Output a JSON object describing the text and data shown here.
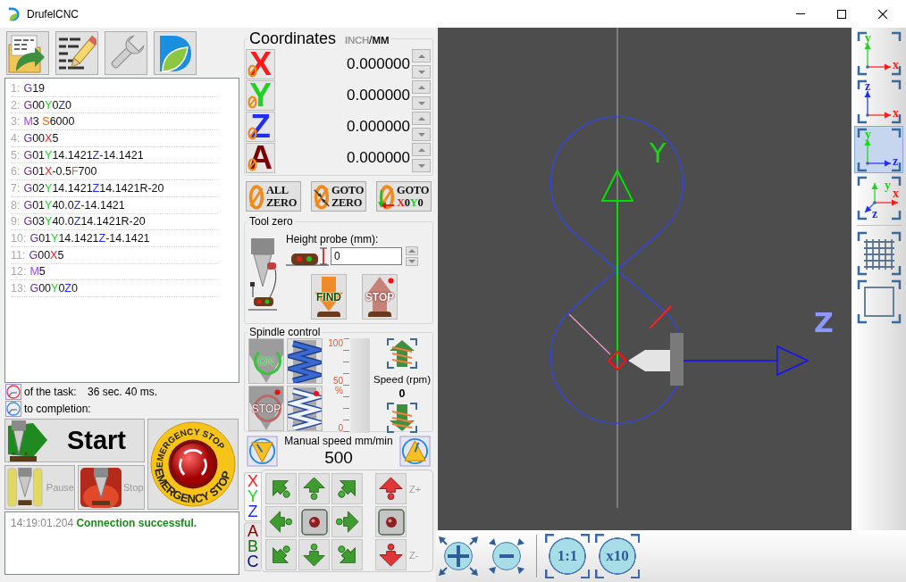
{
  "window": {
    "title": "DrufelCNC"
  },
  "program": {
    "lines": [
      {
        "number": "1:",
        "tokens": [
          {
            "kind": "g",
            "text": "G"
          },
          {
            "kind": "plain",
            "text": "19"
          }
        ]
      },
      {
        "number": "2:",
        "tokens": [
          {
            "kind": "g",
            "text": "G"
          },
          {
            "kind": "plain",
            "text": "00"
          },
          {
            "kind": "y",
            "text": "Y"
          },
          {
            "kind": "plain",
            "text": "0"
          },
          {
            "kind": "z",
            "text": "Z"
          },
          {
            "kind": "plain",
            "text": "0"
          }
        ]
      },
      {
        "number": "3:",
        "tokens": [
          {
            "kind": "m",
            "text": "M"
          },
          {
            "kind": "plain",
            "text": "3 "
          },
          {
            "kind": "feed",
            "text": "S"
          },
          {
            "kind": "plain",
            "text": "6000"
          }
        ]
      },
      {
        "number": "4:",
        "tokens": [
          {
            "kind": "g",
            "text": "G"
          },
          {
            "kind": "plain",
            "text": "00"
          },
          {
            "kind": "x",
            "text": "X"
          },
          {
            "kind": "plain",
            "text": "5"
          }
        ]
      },
      {
        "number": "5:",
        "tokens": [
          {
            "kind": "g",
            "text": "G"
          },
          {
            "kind": "plain",
            "text": "01"
          },
          {
            "kind": "y",
            "text": "Y"
          },
          {
            "kind": "plain",
            "text": "14.1421"
          },
          {
            "kind": "z",
            "text": "Z"
          },
          {
            "kind": "plain",
            "text": "-14.1421"
          }
        ]
      },
      {
        "number": "6:",
        "tokens": [
          {
            "kind": "g",
            "text": "G"
          },
          {
            "kind": "plain",
            "text": "01"
          },
          {
            "kind": "x",
            "text": "X"
          },
          {
            "kind": "plain",
            "text": "-0.5"
          },
          {
            "kind": "feed",
            "text": "F"
          },
          {
            "kind": "plain",
            "text": "700"
          }
        ]
      },
      {
        "number": "7:",
        "tokens": [
          {
            "kind": "g",
            "text": "G"
          },
          {
            "kind": "plain",
            "text": "02"
          },
          {
            "kind": "y",
            "text": "Y"
          },
          {
            "kind": "plain",
            "text": "14.1421"
          },
          {
            "kind": "z",
            "text": "Z"
          },
          {
            "kind": "plain",
            "text": "14.1421R-20"
          }
        ]
      },
      {
        "number": "8:",
        "tokens": [
          {
            "kind": "g",
            "text": "G"
          },
          {
            "kind": "plain",
            "text": "01"
          },
          {
            "kind": "y",
            "text": "Y"
          },
          {
            "kind": "plain",
            "text": "40.0"
          },
          {
            "kind": "z",
            "text": "Z"
          },
          {
            "kind": "plain",
            "text": "-14.1421"
          }
        ]
      },
      {
        "number": "9:",
        "tokens": [
          {
            "kind": "g",
            "text": "G"
          },
          {
            "kind": "plain",
            "text": "03"
          },
          {
            "kind": "y",
            "text": "Y"
          },
          {
            "kind": "plain",
            "text": "40.0"
          },
          {
            "kind": "z",
            "text": "Z"
          },
          {
            "kind": "plain",
            "text": "14.1421R-20"
          }
        ]
      },
      {
        "number": "10:",
        "tokens": [
          {
            "kind": "g",
            "text": "G"
          },
          {
            "kind": "plain",
            "text": "01"
          },
          {
            "kind": "y",
            "text": "Y"
          },
          {
            "kind": "plain",
            "text": "14.1421"
          },
          {
            "kind": "z",
            "text": "Z"
          },
          {
            "kind": "plain",
            "text": "-14.1421"
          }
        ]
      },
      {
        "number": "11:",
        "tokens": [
          {
            "kind": "g",
            "text": "G"
          },
          {
            "kind": "plain",
            "text": "00"
          },
          {
            "kind": "x",
            "text": "X"
          },
          {
            "kind": "plain",
            "text": "5"
          }
        ]
      },
      {
        "number": "12:",
        "tokens": [
          {
            "kind": "m",
            "text": "M"
          },
          {
            "kind": "plain",
            "text": "5"
          }
        ]
      },
      {
        "number": "13:",
        "tokens": [
          {
            "kind": "g",
            "text": "G"
          },
          {
            "kind": "plain",
            "text": "00"
          },
          {
            "kind": "y",
            "text": "Y"
          },
          {
            "kind": "plain",
            "text": "0"
          },
          {
            "kind": "z",
            "text": "Z"
          },
          {
            "kind": "plain",
            "text": "0"
          }
        ]
      }
    ]
  },
  "timers": [
    {
      "label": "of the task:",
      "value": "36 sec. 40 ms."
    },
    {
      "label": "to completion:"
    }
  ],
  "run_controls": [
    {
      "kind": "start",
      "label": "Start",
      "disabled": false
    },
    {
      "kind": "pause",
      "label": "Pause",
      "disabled": true
    },
    {
      "kind": "stop",
      "label": "Stop",
      "disabled": true
    }
  ],
  "emergency_stop": {
    "ring_texts": [
      "EMERGENCY STOP",
      "EMERGENCY STOP"
    ]
  },
  "log": [
    {
      "time": "14:19:01.204",
      "message": "Connection successful.",
      "kind": "success"
    }
  ],
  "coordinates": {
    "title": "Coordinates",
    "units": [
      {
        "label": "INCH",
        "selected": false
      },
      {
        "label": "MM",
        "selected": true
      }
    ],
    "unit_separator": "/",
    "axes": [
      {
        "kind": "x",
        "letter": "X",
        "value": "0.000000"
      },
      {
        "kind": "y",
        "letter": "Y",
        "value": "0.000000"
      },
      {
        "kind": "z",
        "letter": "Z",
        "value": "0.000000"
      },
      {
        "kind": "a",
        "letter": "A",
        "value": "0.000000"
      }
    ]
  },
  "zero_buttons": [
    {
      "kind": "all",
      "lines": [
        [
          {
            "kind": "plain",
            "text": "ALL"
          }
        ],
        [
          {
            "kind": "plain",
            "text": "ZERO"
          }
        ]
      ]
    },
    {
      "kind": "goto-zero",
      "lines": [
        [
          {
            "kind": "plain",
            "text": "GOTO"
          }
        ],
        [
          {
            "kind": "plain",
            "text": "ZERO"
          }
        ]
      ]
    },
    {
      "kind": "goto-xy",
      "lines": [
        [
          {
            "kind": "plain",
            "text": "GOTO"
          }
        ],
        [
          {
            "kind": "x",
            "text": "X"
          },
          {
            "kind": "plain",
            "text": "0"
          },
          {
            "kind": "y",
            "text": "Y"
          },
          {
            "kind": "plain",
            "text": "0"
          }
        ]
      ]
    }
  ],
  "tool_zero": {
    "title": "Tool zero",
    "probe_label": "Height probe (mm):",
    "probe_value": "0",
    "buttons": [
      {
        "kind": "find",
        "label": "FIND",
        "disabled": false
      },
      {
        "kind": "stop",
        "label": "STOP",
        "disabled": true
      }
    ]
  },
  "spindle": {
    "title": "Spindle control",
    "buttons": [
      {
        "kind": "on",
        "label": "ON",
        "disabled": false
      },
      {
        "kind": "stop",
        "label": "STOP",
        "disabled": true
      }
    ],
    "scale_labels": [
      "100",
      "50",
      "%",
      "0"
    ],
    "speed_label": "Speed (rpm)",
    "speed_value": "0"
  },
  "manual_speed": {
    "label": "Manual speed mm/min",
    "value": "500"
  },
  "jog": {
    "tabs": [
      {
        "selected": true,
        "letters": [
          {
            "kind": "x",
            "text": "X"
          },
          {
            "kind": "y",
            "text": "Y"
          },
          {
            "kind": "z",
            "text": "Z"
          }
        ]
      },
      {
        "selected": false,
        "letters": [
          {
            "kind": "a",
            "text": "A"
          },
          {
            "kind": "b",
            "text": "B"
          },
          {
            "kind": "c",
            "text": "C"
          }
        ]
      }
    ],
    "z_labels": [
      "Z+",
      "Z-"
    ]
  },
  "view": {
    "axis_labels": [
      {
        "kind": "y",
        "text": "Y"
      },
      {
        "kind": "z",
        "text": "Z"
      }
    ],
    "view_buttons": [
      {
        "kind": "plane",
        "selected": false,
        "axes": [
          {
            "kind": "y",
            "text": "y"
          },
          {
            "kind": "x",
            "text": "x"
          }
        ]
      },
      {
        "kind": "plane",
        "selected": false,
        "axes": [
          {
            "kind": "z",
            "text": "z"
          },
          {
            "kind": "x",
            "text": "x"
          }
        ]
      },
      {
        "kind": "plane",
        "selected": true,
        "axes": [
          {
            "kind": "y",
            "text": "y"
          },
          {
            "kind": "z",
            "text": "z"
          }
        ]
      },
      {
        "kind": "iso",
        "selected": false,
        "axes": [
          {
            "kind": "y",
            "text": "y"
          },
          {
            "kind": "x",
            "text": "x"
          },
          {
            "kind": "z",
            "text": "z"
          }
        ]
      },
      {
        "kind": "grid",
        "selected": false
      },
      {
        "kind": "frame",
        "selected": false
      }
    ]
  },
  "zoom_buttons": [
    {
      "label": "1:1"
    },
    {
      "label": "x10"
    }
  ]
}
